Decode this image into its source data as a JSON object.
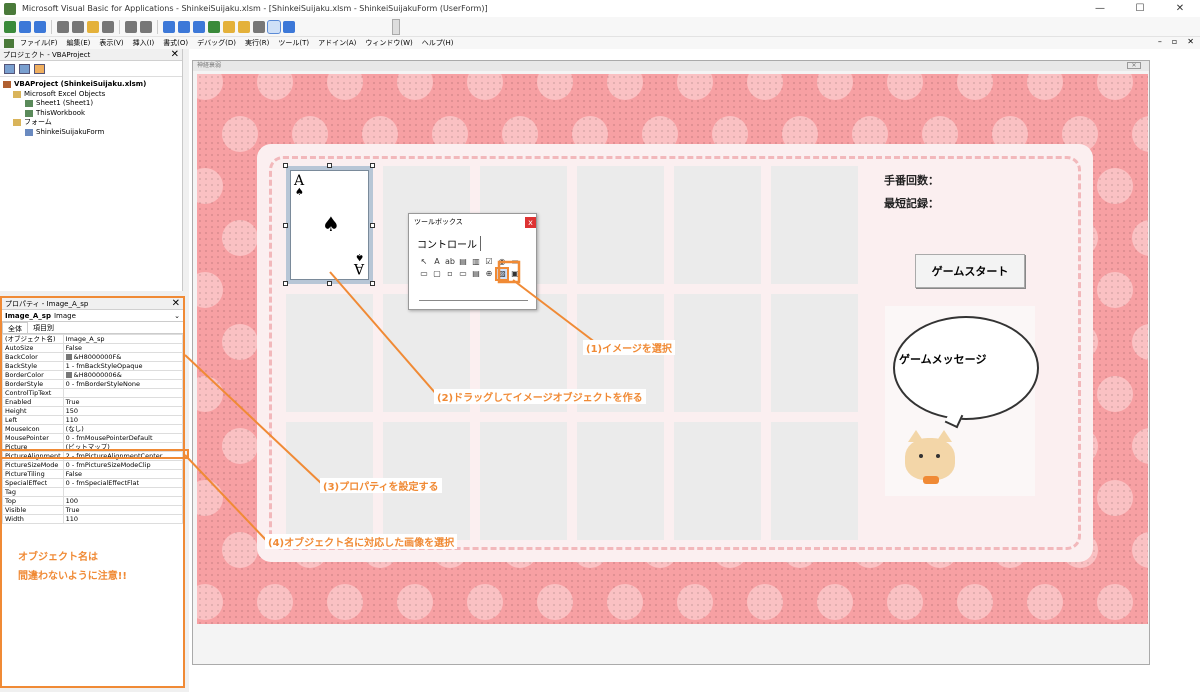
{
  "window": {
    "title": "Microsoft Visual Basic for Applications - ShinkeiSuijaku.xlsm - [ShinkeiSuijaku.xlsm - ShinkeiSuijakuForm (UserForm)]",
    "controls": [
      "—",
      "☐",
      "✕"
    ]
  },
  "menu": {
    "items": [
      "ファイル(F)",
      "編集(E)",
      "表示(V)",
      "挿入(I)",
      "書式(O)",
      "デバッグ(D)",
      "実行(R)",
      "ツール(T)",
      "アドイン(A)",
      "ウィンドウ(W)",
      "ヘルプ(H)"
    ],
    "mdi_controls": [
      "–",
      "▫",
      "✕"
    ]
  },
  "project": {
    "header": "プロジェクト - VBAProject",
    "close": "✕",
    "tree": [
      {
        "label": "VBAProject (ShinkeiSuijaku.xlsm)",
        "level": 0,
        "icon": "project"
      },
      {
        "label": "Microsoft Excel Objects",
        "level": 1,
        "icon": "folder"
      },
      {
        "label": "Sheet1 (Sheet1)",
        "level": 2,
        "icon": "sheet"
      },
      {
        "label": "ThisWorkbook",
        "level": 2,
        "icon": "sheet"
      },
      {
        "label": "フォーム",
        "level": 1,
        "icon": "folder"
      },
      {
        "label": "ShinkeiSuijakuForm",
        "level": 2,
        "icon": "form"
      }
    ]
  },
  "properties": {
    "header": "プロパティ - Image_A_sp",
    "close": "✕",
    "object_name": "Image_A_sp",
    "object_type": "Image",
    "tabs": [
      "全体",
      "項目別"
    ],
    "rows": [
      [
        "(オブジェクト名)",
        "Image_A_sp"
      ],
      [
        "AutoSize",
        "False"
      ],
      [
        "BackColor",
        "&H8000000F&"
      ],
      [
        "BackStyle",
        "1 - fmBackStyleOpaque"
      ],
      [
        "BorderColor",
        "&H80000006&"
      ],
      [
        "BorderStyle",
        "0 - fmBorderStyleNone"
      ],
      [
        "ControlTipText",
        ""
      ],
      [
        "Enabled",
        "True"
      ],
      [
        "Height",
        "150"
      ],
      [
        "Left",
        "110"
      ],
      [
        "MouseIcon",
        "(なし)"
      ],
      [
        "MousePointer",
        "0 - fmMousePointerDefault"
      ],
      [
        "Picture",
        "(ビットマップ)"
      ],
      [
        "PictureAlignment",
        "2 - fmPictureAlignmentCenter"
      ],
      [
        "PictureSizeMode",
        "0 - fmPictureSizeModeClip"
      ],
      [
        "PictureTiling",
        "False"
      ],
      [
        "SpecialEffect",
        "0 - fmSpecialEffectFlat"
      ],
      [
        "Tag",
        ""
      ],
      [
        "Top",
        "100"
      ],
      [
        "Visible",
        "True"
      ],
      [
        "Width",
        "110"
      ]
    ],
    "note_line1": "オブジェクト名は",
    "note_line2": "間違わないように注意!!"
  },
  "form": {
    "caption": "神経衰弱",
    "close": "✕",
    "card": {
      "rank": "A",
      "suit": "♠"
    },
    "moves_label": "手番回数：",
    "best_label": "最短記録：",
    "start_button": "ゲームスタート",
    "message": "ゲームメッセージ"
  },
  "toolbox": {
    "title": "ツールボックス",
    "close": "x",
    "tab": "コントロール",
    "icons": [
      "↖",
      "A",
      "ab",
      "▤",
      "▥",
      "☑",
      "◉",
      "▬",
      "",
      "▭",
      "▢",
      "▫",
      "▭",
      "▤",
      "⊕",
      "▨",
      "▣",
      ""
    ]
  },
  "annotations": {
    "step1": "(1)イメージを選択",
    "step2": "(2)ドラッグしてイメージオブジェクトを作る",
    "step3": "(3)プロパティを設定する",
    "step4": "(4)オブジェクト名に対応した画像を選択"
  },
  "colors": {
    "accent": "#f08a35",
    "form_bg": "#f7a0a3",
    "board": "#fbeff0"
  }
}
